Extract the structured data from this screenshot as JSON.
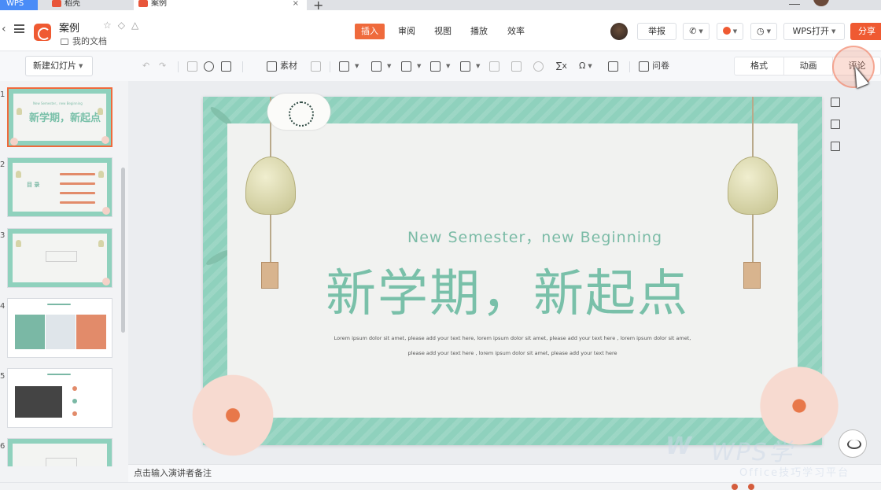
{
  "tabs": {
    "wps": "WPS",
    "tab1": "稻壳",
    "tab2": "案例",
    "add": "+",
    "close": "×"
  },
  "titlebar": {
    "back": "‹",
    "doc_title": "案例",
    "doc_icons": "☆◇△",
    "folder": "我的文档"
  },
  "menu": {
    "insert": "插入",
    "review": "审阅",
    "view": "视图",
    "play": "播放",
    "effects": "效率"
  },
  "actions": {
    "report": "举报",
    "wps_open": "WPS打开",
    "share": "分享"
  },
  "toolbar": {
    "new_slide": "新建幻灯片",
    "undo": "↶",
    "redo": "↷",
    "material": "素材",
    "ask": "问卷",
    "sigma": "∑x",
    "omega": "Ω"
  },
  "right_tabs": {
    "format": "格式",
    "animation": "动画",
    "comment": "评论"
  },
  "sidebar": {
    "numbers": [
      "1",
      "2",
      "3",
      "4",
      "5",
      "6"
    ],
    "thumb1_title": "新学期，新起点",
    "thumb1_sub": "New Semester，new Beginning",
    "thumb2_title": "目  录"
  },
  "slide": {
    "subtitle": "New Semester，new Beginning",
    "title": "新学期，新起点",
    "lorem1": "Lorem ipsum dolor sit amet, please add your text here, lorem ipsum dolor sit amet, please add your text here , lorem ipsum dolor sit amet,",
    "lorem2": "please add your text here , lorem ipsum dolor sit amet, please add your text here"
  },
  "notes": {
    "placeholder": "点击输入演讲者备注"
  },
  "watermark": {
    "logo": "W",
    "text": "WPS学",
    "sub": "Office技巧学习平台"
  },
  "colors": {
    "accent": "#ef5a32",
    "slide_green": "#8fd1bd",
    "title_green": "#79c0a9"
  }
}
